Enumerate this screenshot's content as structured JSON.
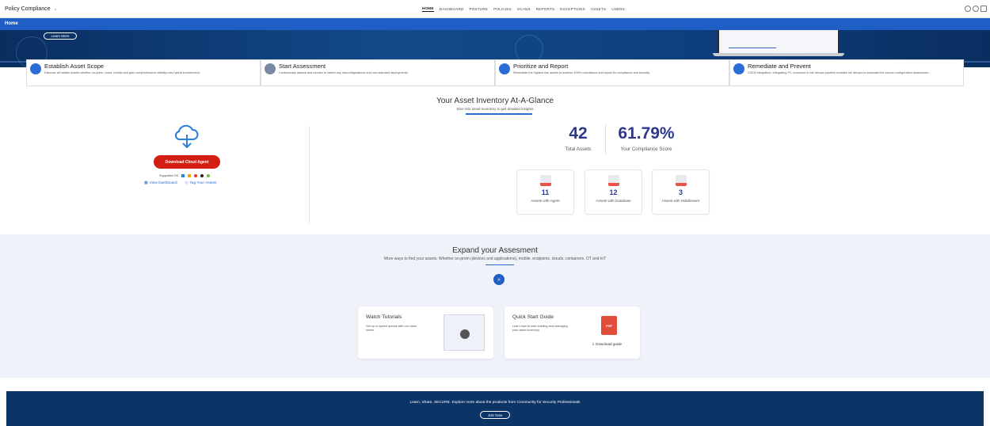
{
  "topbar": {
    "app_title": "Policy Compliance",
    "nav": [
      "HOME",
      "DASHBOARD",
      "POSTURE",
      "POLICIES",
      "SCANS",
      "REPORTS",
      "EXCEPTIONS",
      "ASSETS",
      "USERS"
    ],
    "active_nav": "HOME"
  },
  "subbar": {
    "title": "Home"
  },
  "hero": {
    "learn_more": "Learn More"
  },
  "steps": [
    {
      "title": "Establish Asset Scope",
      "desc": "Discover all hidden Assets whether on-prem, cloud, mobile and gain comprehensive visibility into hybrid environment."
    },
    {
      "title": "Start Assessment",
      "desc": "Continuously assess and monitor to detect any misconfigurations and non-standard deployments."
    },
    {
      "title": "Prioritize and Report",
      "desc": "Remediate the highest risk assets to achieve 100% compliance and report for compliance and security."
    },
    {
      "title": "Remediate and Prevent",
      "desc": "CI/CD Integration: Integrating PC connector in the devops pipeline enables the devops to automate the secure configuration assessmen..."
    }
  ],
  "glance": {
    "title": "Your Asset Inventory At-A-Glance",
    "subtitle": "Dive into asset inventory to get detailed insights",
    "download_btn": "Download Cloud Agent",
    "supported_os": "Supported OS",
    "view_dashboard": "View Dashboard",
    "tag_assets": "Tag Your Assets",
    "total_assets": "42",
    "total_assets_label": "Total Assets",
    "compliance_score": "61.79%",
    "compliance_label": "Your Compliance Score",
    "mini": [
      {
        "num": "11",
        "label": "Assets with Agent"
      },
      {
        "num": "12",
        "label": "Assets with Database"
      },
      {
        "num": "3",
        "label": "Assets with Middleware"
      }
    ]
  },
  "expand": {
    "title": "Expand your Assesment",
    "subtitle": "More ways to find your assets. Whether on-prem (devices and applications), mobile, endpoints, clouds, containers, OT and IoT",
    "tutorials_title": "Watch Tutorials",
    "tutorials_desc": "Get up to speed quickly with our video series.",
    "guide_title": "Quick Start Guide",
    "guide_desc": "Learn how to start building and managing your asset inventory",
    "guide_pdf": "PDF",
    "guide_download": "Download guide"
  },
  "footer": {
    "text": "Learn, Share, SECURE. Explore more about the products from Community for Security Professionals",
    "join": "Join Now"
  }
}
